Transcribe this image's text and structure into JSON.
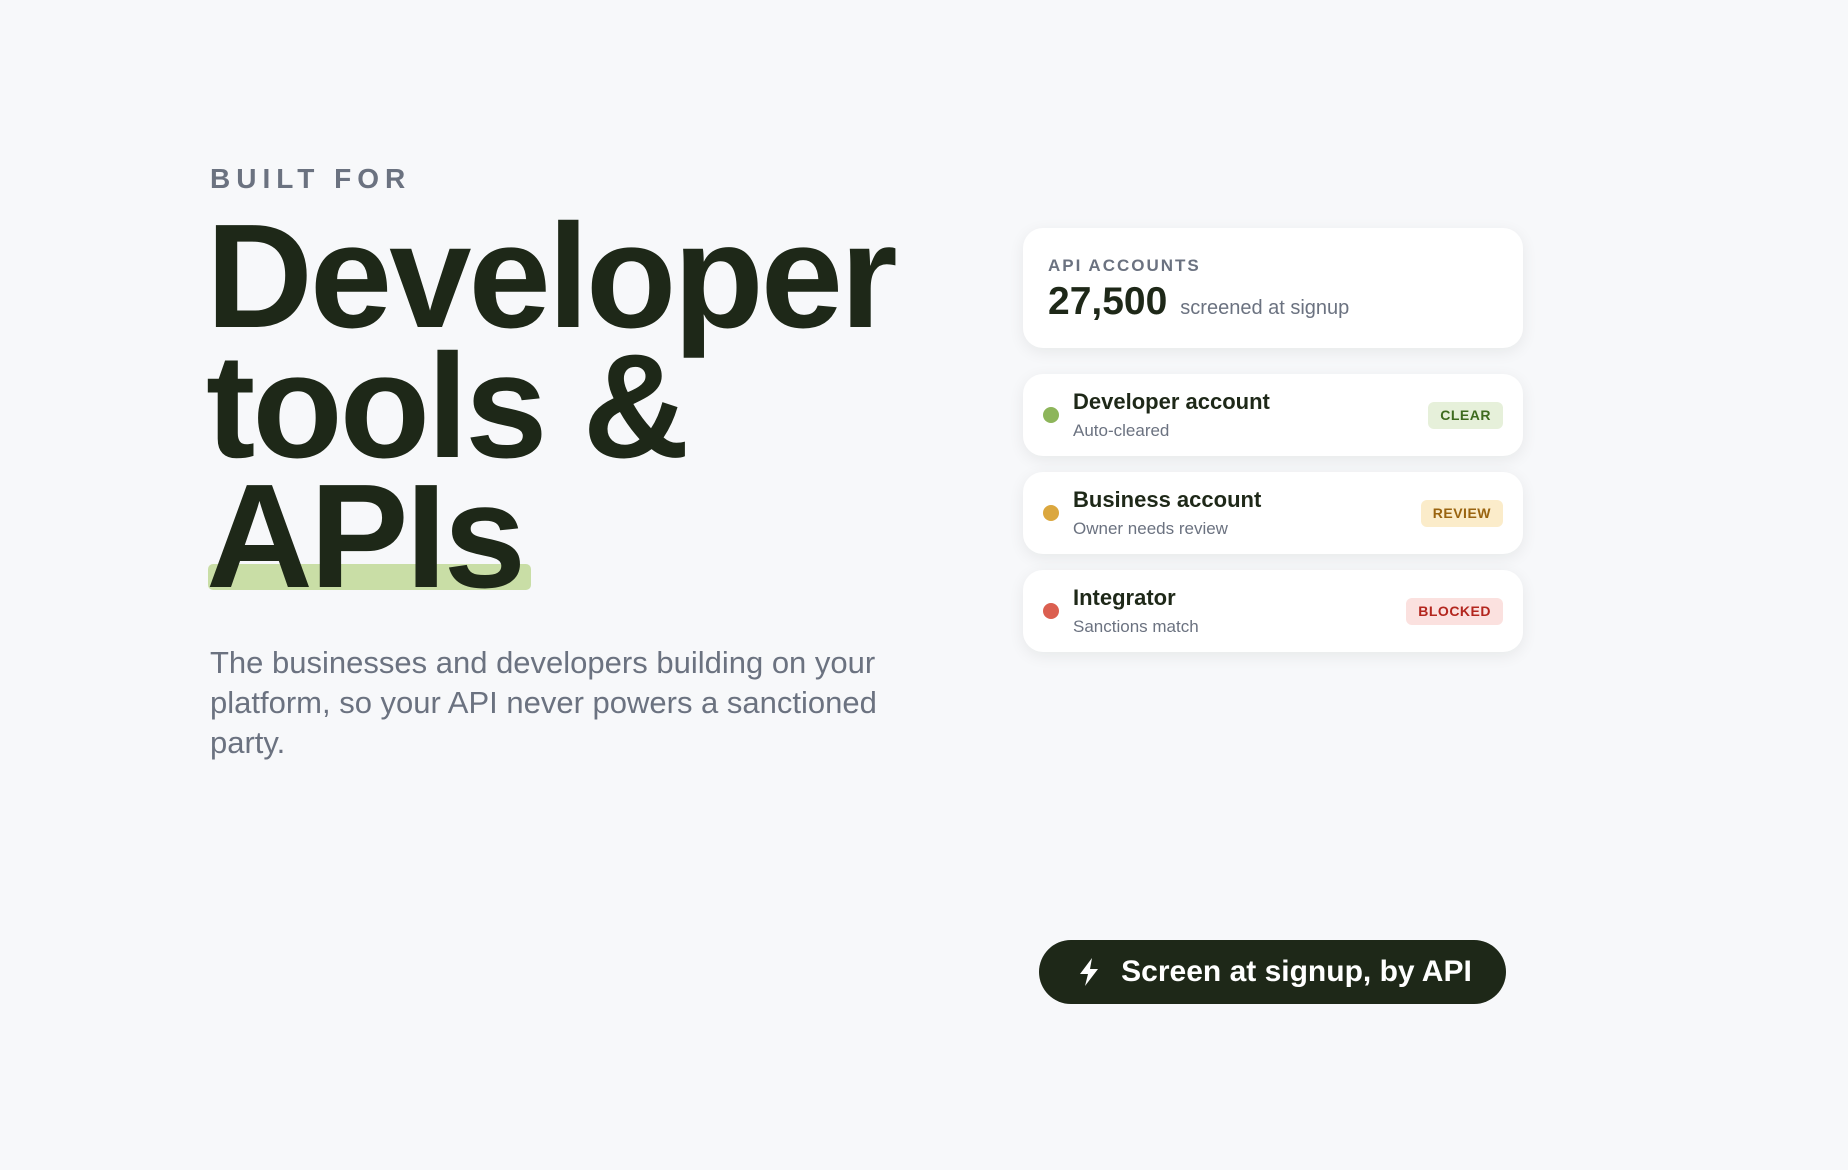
{
  "hero": {
    "eyebrow": "BUILT FOR",
    "headline_line1": "Developer",
    "headline_line2": "tools &",
    "headline_line3": "APIs",
    "subhead": "The businesses and developers building on your platform, so your API never powers a sanctioned party."
  },
  "stats": {
    "label": "API ACCOUNTS",
    "number": "27,500",
    "caption": "screened at signup"
  },
  "rows": [
    {
      "title": "Developer account",
      "subtitle": "Auto-cleared",
      "badge": "CLEAR",
      "dot_color": "#8db55a",
      "badge_bg": "#e6f0da",
      "badge_color": "#3e6b1f"
    },
    {
      "title": "Business account",
      "subtitle": "Owner needs review",
      "badge": "REVIEW",
      "dot_color": "#dba73e",
      "badge_bg": "#fbecca",
      "badge_color": "#9a6410"
    },
    {
      "title": "Integrator",
      "subtitle": "Sanctions match",
      "badge": "BLOCKED",
      "dot_color": "#db5f50",
      "badge_bg": "#fbe1df",
      "badge_color": "#b3261e"
    }
  ],
  "cta": {
    "icon": "lightning-bolt-icon",
    "label": "Screen at signup, by API"
  },
  "colors": {
    "background": "#f7f8fa",
    "ink": "#1e2818",
    "muted": "#6b7280",
    "highlight": "#c9dea6"
  }
}
